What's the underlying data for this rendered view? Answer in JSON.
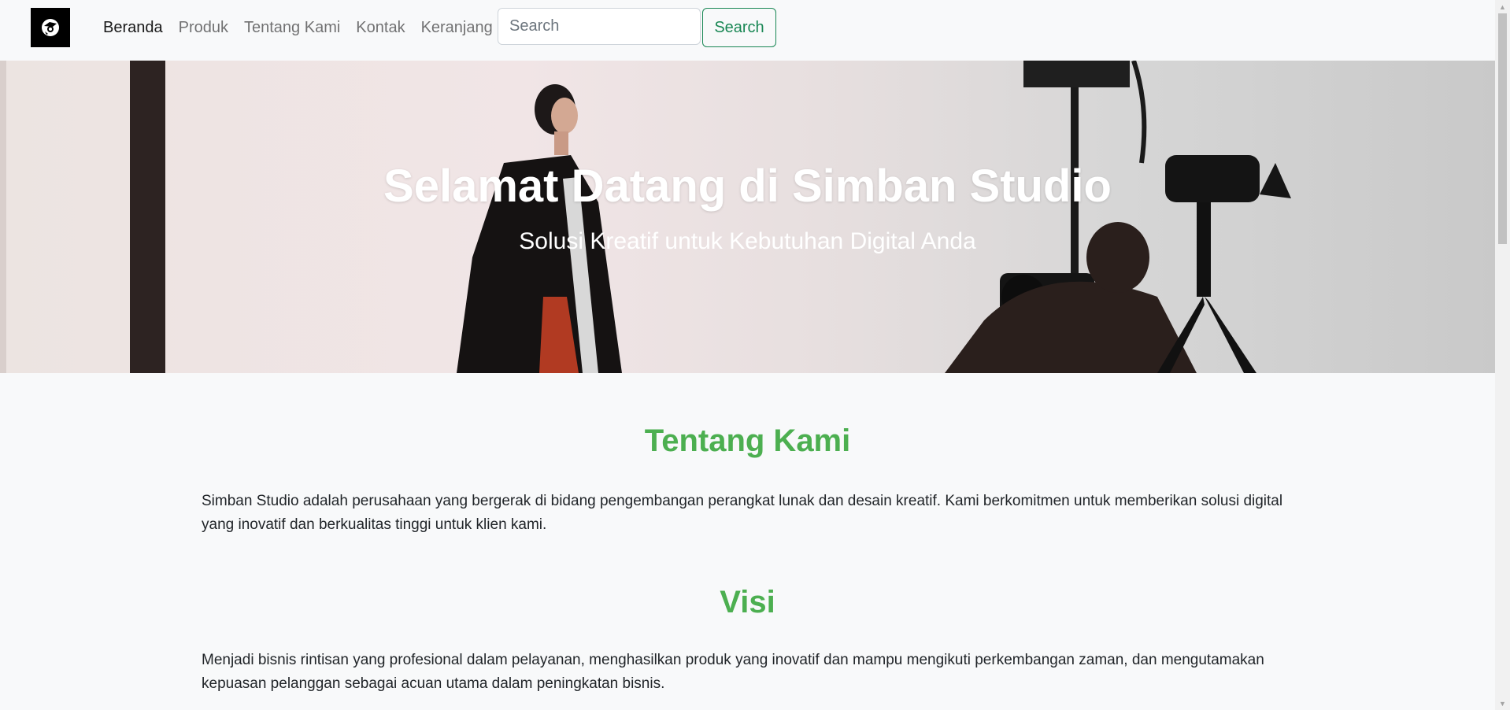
{
  "navbar": {
    "logo_icon": "camera-logo-icon",
    "links": [
      {
        "label": "Beranda",
        "active": true
      },
      {
        "label": "Produk",
        "active": false
      },
      {
        "label": "Tentang Kami",
        "active": false
      },
      {
        "label": "Kontak",
        "active": false
      },
      {
        "label": "Keranjang",
        "active": false
      }
    ],
    "search": {
      "placeholder": "Search",
      "value": ""
    },
    "search_button": "Search"
  },
  "hero": {
    "title": "Selamat Datang di Simban Studio",
    "subtitle": "Solusi Kreatif untuk Kebutuhan Digital Anda"
  },
  "about": {
    "title": "Tentang Kami",
    "text": "Simban Studio adalah perusahaan yang bergerak di bidang pengembangan perangkat lunak dan desain kreatif. Kami berkomitmen untuk memberikan solusi digital yang inovatif dan berkualitas tinggi untuk klien kami."
  },
  "vision": {
    "title": "Visi",
    "text": "Menjadi bisnis rintisan yang profesional dalam pelayanan, menghasilkan produk yang inovatif dan mampu mengikuti perkembangan zaman, dan mengutamakan kepuasan pelanggan sebagai acuan utama dalam peningkatan bisnis."
  },
  "colors": {
    "accent_green": "#4caf50",
    "button_green": "#198754",
    "navbar_bg": "#f8f9fa"
  }
}
